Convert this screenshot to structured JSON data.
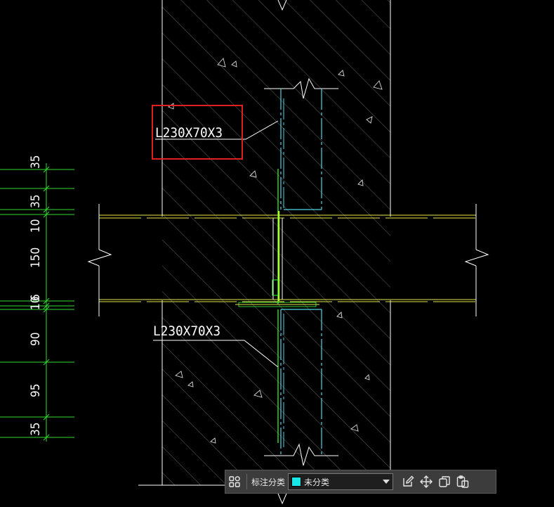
{
  "drawing": {
    "annotation_top": "L230X70X3",
    "annotation_bottom": "L230X70X3",
    "dimensions": [
      "35",
      "35",
      "10",
      "150",
      "10",
      "6",
      "90",
      "95",
      "35"
    ]
  },
  "colors": {
    "background": "#000000",
    "hatch": "#ffffff",
    "steel_cyan": "#4fd6e6",
    "weld_green": "#40ff40",
    "slab_yellow": "#e6e64a",
    "dimension_green": "#2fdc2f",
    "highlight_red": "#e02020"
  },
  "toolbar": {
    "grid_icon": "grid-four-icon",
    "label": "标注分类",
    "select_value": "未分类",
    "select_swatch": "#19e6e6",
    "actions": [
      "edit-icon",
      "move-icon",
      "copy-icon",
      "paste-icon"
    ]
  }
}
